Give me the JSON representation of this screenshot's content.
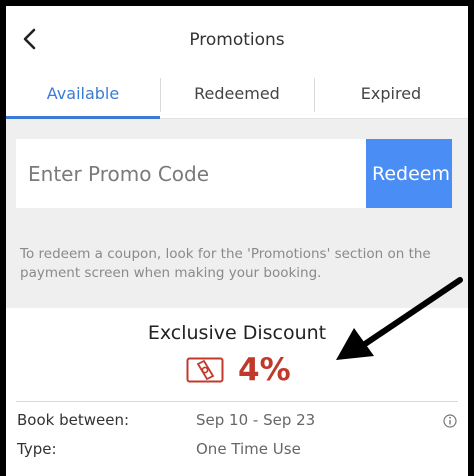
{
  "header": {
    "title": "Promotions",
    "back_icon": "chevron-left-icon"
  },
  "tabs": [
    {
      "label": "Available",
      "active": true
    },
    {
      "label": "Redeemed",
      "active": false
    },
    {
      "label": "Expired",
      "active": false
    }
  ],
  "promo": {
    "placeholder": "Enter Promo Code",
    "value": "",
    "redeem_label": "Redeem",
    "hint": "To redeem a coupon, look for the 'Promotions' section on the payment screen when making your booking."
  },
  "offer": {
    "title": "Exclusive Discount",
    "icon": "coupon-icon",
    "value": "4%",
    "details": [
      {
        "label": "Book between:",
        "value": "Sep 10 - Sep 23",
        "info_icon": true
      },
      {
        "label": "Type:",
        "value": "One Time Use",
        "info_icon": false
      }
    ]
  },
  "colors": {
    "accent": "#3b7bd6",
    "button": "#4a8ef5",
    "discount": "#c0392b",
    "panel": "#efefef"
  }
}
